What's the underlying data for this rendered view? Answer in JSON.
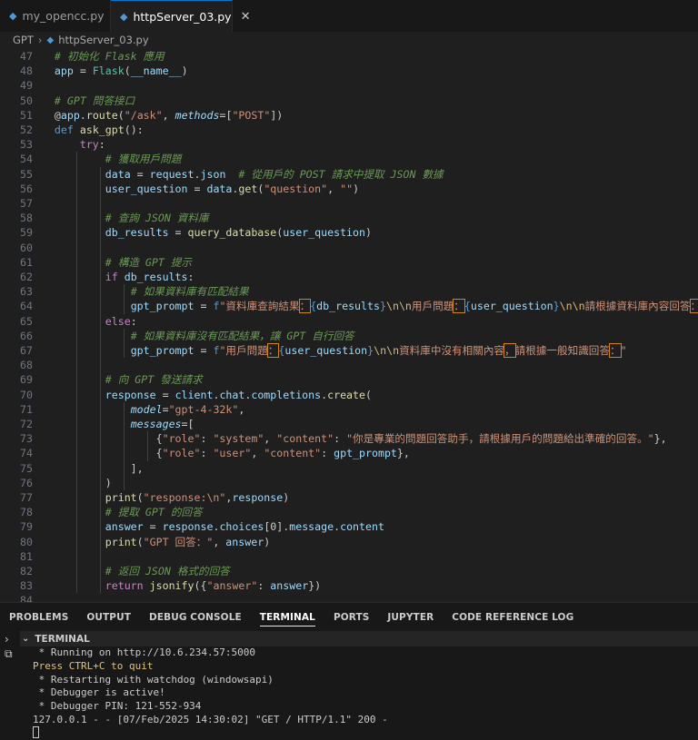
{
  "tabs": [
    {
      "label": "my_opencc.py",
      "icon": "python-file-icon"
    },
    {
      "label": "httpServer_03.py",
      "icon": "python-file-icon",
      "close": "✕"
    }
  ],
  "breadcrumb": {
    "folder": "GPT",
    "separator": "›",
    "file": "httpServer_03.py"
  },
  "editor": {
    "line_numbers": [
      "47",
      "48",
      "49",
      "50",
      "51",
      "52",
      "53",
      "54",
      "55",
      "56",
      "57",
      "58",
      "59",
      "60",
      "61",
      "62",
      "63",
      "64",
      "65",
      "66",
      "67",
      "68",
      "69",
      "70",
      "71",
      "72",
      "73",
      "74",
      "75",
      "76",
      "77",
      "78",
      "79",
      "80",
      "81",
      "82",
      "83",
      "84"
    ],
    "lines": [
      "    # 初始化 Flask 應用",
      "    app = Flask(__name__)",
      "",
      "    # GPT 問答接口",
      "    @app.route(\"/ask\", methods=[\"POST\"])",
      "    def ask_gpt():",
      "        try:",
      "            # 獲取用戶問題",
      "            data = request.json  # 從用戶的 POST 請求中提取 JSON 數據",
      "            user_question = data.get(\"question\", \"\")",
      "",
      "            # 查詢 JSON 資料庫",
      "            db_results = query_database(user_question)",
      "",
      "            # 構造 GPT 提示",
      "            if db_results:",
      "                # 如果資料庫有匹配結果",
      "                gpt_prompt = f\"資料庫查詢結果：{db_results}\\n\\n用戶問題：{user_question}\\n\\n請根據資料庫內容回答：\"",
      "            else:",
      "                # 如果資料庫沒有匹配結果，讓 GPT 自行回答",
      "                gpt_prompt = f\"用戶問題：{user_question}\\n\\n資料庫中沒有相關內容，請根據一般知識回答：\"",
      "",
      "            # 向 GPT 發送請求",
      "            response = client.chat.completions.create(",
      "                model=\"gpt-4-32k\",",
      "                messages=[",
      "                    {\"role\": \"system\", \"content\": \"你是專業的問題回答助手，請根據用戶的問題給出準確的回答。\"},",
      "                    {\"role\": \"user\", \"content\": gpt_prompt},",
      "                ],",
      "            )",
      "            print(\"response:\\n\",response)",
      "            # 提取 GPT 的回答",
      "            answer = response.choices[0].message.content",
      "            print(\"GPT 回答：\", answer)",
      "",
      "            # 返回 JSON 格式的回答",
      "            return jsonify({\"answer\": answer})",
      ""
    ]
  },
  "panel": {
    "tabs": [
      "PROBLEMS",
      "OUTPUT",
      "DEBUG CONSOLE",
      "TERMINAL",
      "PORTS",
      "JUPYTER",
      "CODE REFERENCE LOG"
    ],
    "active_tab": "TERMINAL",
    "terminal_header": "TERMINAL",
    "terminal_lines": [
      " * Running on http://10.6.234.57:5000",
      "Press CTRL+C to quit",
      " * Restarting with watchdog (windowsapi)",
      " * Debugger is active!",
      " * Debugger PIN: 121-552-934",
      "127.0.0.1 - - [07/Feb/2025 14:30:02] \"GET / HTTP/1.1\" 200 -"
    ]
  },
  "colors": {
    "accent": "#0078d4",
    "comment": "#6a9955",
    "keyword": "#c586c0",
    "string": "#ce9178",
    "function": "#dcdcaa",
    "variable": "#9cdcfe",
    "terminal_warn": "#e5c07b"
  }
}
